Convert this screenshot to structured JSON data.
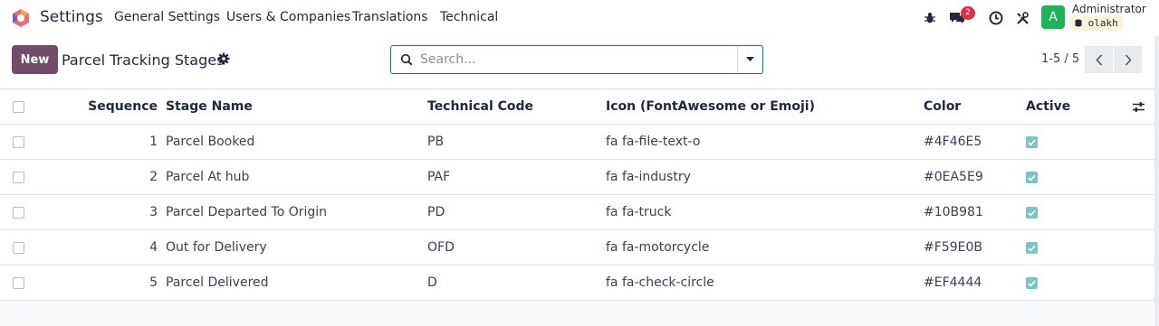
{
  "nav": {
    "app_name": "Settings",
    "menu": [
      "General Settings",
      "Users & Companies",
      "Translations",
      "Technical"
    ],
    "message_count": "2",
    "user_initial": "A",
    "user_name": "Administrator",
    "database": "olakh"
  },
  "control": {
    "new_label": "New",
    "title": "Parcel Tracking Stages",
    "search_placeholder": "Search...",
    "pager": "1-5 / 5"
  },
  "table": {
    "columns": {
      "sequence": "Sequence",
      "name": "Stage Name",
      "code": "Technical Code",
      "icon": "Icon (FontAwesome or Emoji)",
      "color": "Color",
      "active": "Active"
    },
    "rows": [
      {
        "sequence": "1",
        "name": "Parcel Booked",
        "code": "PB",
        "icon": "fa fa-file-text-o",
        "color": "#4F46E5",
        "active": true
      },
      {
        "sequence": "2",
        "name": "Parcel At hub",
        "code": "PAF",
        "icon": "fa fa-industry",
        "color": "#0EA5E9",
        "active": true
      },
      {
        "sequence": "3",
        "name": "Parcel Departed To Origin",
        "code": "PD",
        "icon": "fa fa-truck",
        "color": "#10B981",
        "active": true
      },
      {
        "sequence": "4",
        "name": "Out for Delivery",
        "code": "OFD",
        "icon": "fa fa-motorcycle",
        "color": "#F59E0B",
        "active": true
      },
      {
        "sequence": "5",
        "name": "Parcel Delivered",
        "code": "D",
        "icon": "fa fa-check-circle",
        "color": "#EF4444",
        "active": true
      }
    ]
  },
  "icons": [
    "app-logo-icon",
    "bug-icon",
    "chat-icon",
    "clock-icon",
    "tools-icon",
    "database-icon",
    "gear-icon",
    "search-icon",
    "caret-down-icon",
    "chevron-left-icon",
    "chevron-right-icon",
    "column-settings-icon",
    "checkmark-icon"
  ],
  "colors": {
    "primary": "#714b67",
    "search_border": "#017e84",
    "badge": "#d9304c",
    "avatar": "#1fb25a",
    "active_check": "#7cc3c4"
  }
}
